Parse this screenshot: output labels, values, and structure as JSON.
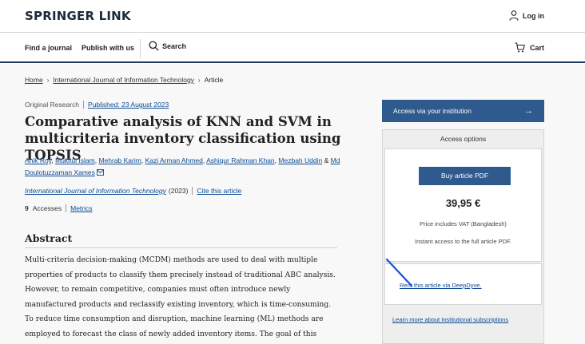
{
  "header": {
    "logo": "SPRINGER LINK",
    "login_label": "Log in"
  },
  "nav": {
    "find_journal": "Find a journal",
    "publish": "Publish with us",
    "search": "Search",
    "cart": "Cart"
  },
  "breadcrumb": {
    "home": "Home",
    "journal": "International Journal of Information Technology",
    "current": "Article"
  },
  "article": {
    "type": "Original Research",
    "published": "Published: 23 August 2023",
    "title": "Comparative analysis of KNN and SVM in multicriteria inventory classification using TOPSIS",
    "authors": [
      "Anik Roy",
      "Mukitul Islam",
      "Mehrab Karim",
      "Kazi Arman Ahmed",
      "Ashiqur Rahman Khan",
      "Mezbah Uddin"
    ],
    "author_and": "&",
    "last_author": "Md Doulotuzzaman Xames",
    "journal_name": "International Journal of Information Technology",
    "year": "(2023)",
    "cite": "Cite this article",
    "accesses_count": "9",
    "accesses_label": "Accesses",
    "metrics": "Metrics"
  },
  "abstract": {
    "heading": "Abstract",
    "text": "Multi-criteria decision-making (MCDM) methods are used to deal with multiple properties of products to classify them precisely instead of traditional ABC analysis. However, to remain competitive, companies must often introduce newly manufactured products and reclassify existing inventory, which is time-consuming. To reduce time consumption and disruption, machine learning (ML) methods are employed to forecast the class of newly added inventory items. The goal of this research is to compare support vector machine (SVM), and K-nearest"
  },
  "sidebar": {
    "access_institution": "Access via your institution",
    "access_options": "Access options",
    "buy_pdf": "Buy article PDF",
    "price": "39,95 €",
    "vat_note": "Price includes VAT (Bangladesh)",
    "instant": "Instant access to the full article PDF.",
    "rent": "Rent this article via DeepDyve.",
    "learn_more": "Learn more about Institutional subscriptions"
  },
  "colors": {
    "primary": "#2f5a8d",
    "link": "#0c4a93",
    "nav_border": "#1e3a5f",
    "annotation": "#1a4fd6"
  },
  "icons": [
    "person-icon",
    "search-icon",
    "cart-icon",
    "chevron-right-icon",
    "mail-icon",
    "arrow-right-icon"
  ]
}
